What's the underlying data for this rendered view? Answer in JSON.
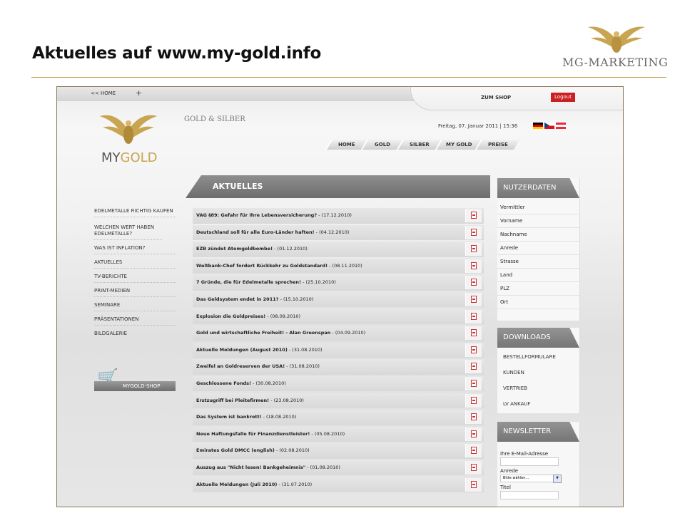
{
  "slide": {
    "title": "Aktuelles auf www.my-gold.info",
    "logo_text": "MG-MARKETING",
    "accent": "#c69a3a"
  },
  "site": {
    "top": {
      "home_link": "<< HOME",
      "plus": "+",
      "shop_link": "ZUM SHOP",
      "logout": "Logout"
    },
    "logo": {
      "my": "MY",
      "gold": "GOLD"
    },
    "tagline": "GOLD & SILBER",
    "date": "Freitag, 07. Januar 2011 | 15:36",
    "nav": [
      "HOME",
      "GOLD",
      "SILBER",
      "MY GOLD",
      "PREISE"
    ],
    "sidebar": [
      "EDELMETALLE RICHTIG KAUFEN",
      "WELCHEN WERT HABEN EDELMETALLE?",
      "WAS IST INFLATION?",
      "AKTUELLES",
      "TV-BERICHTE",
      "PRINT-MEDIEN",
      "SEMINARE",
      "PRÄSENTATIONEN",
      "BILDGALERIE"
    ],
    "shop_button": "MYGOLD-SHOP",
    "section_title": "AKTUELLES",
    "news": [
      {
        "headline": "VAG §89: Gefahr für Ihre Lebensversicherung?",
        "date": " - (17.12.2010)"
      },
      {
        "headline": "Deutschland soll für alle Euro-Länder haften!",
        "date": " - (04.12.2010)"
      },
      {
        "headline": "EZB zündet Atomgeldbombe!",
        "date": " - (01.12.2010)"
      },
      {
        "headline": "Weltbank-Chef fordert Rückkehr zu Goldstandard!",
        "date": " - (08.11.2010)"
      },
      {
        "headline": "7 Gründe, die für Edelmetalle sprechen!",
        "date": " - (25.10.2010)"
      },
      {
        "headline": "Das Geldsystem endet in 2011?",
        "date": " - (15.10.2010)"
      },
      {
        "headline": "Explosion die Goldpreises!",
        "date": " - (08.09.2010)"
      },
      {
        "headline": "Gold und wirtschaftliche Freiheit! - Alan Greenspan",
        "date": " - (04.09.2010)"
      },
      {
        "headline": "Aktuelle Meldungen (August 2010)",
        "date": " - (31.08.2010)"
      },
      {
        "headline": "Zweifel an Goldreserven der USA!",
        "date": " - (31.08.2010)"
      },
      {
        "headline": "Geschlossene Fonds!",
        "date": " - (30.08.2010)"
      },
      {
        "headline": "Erstzugriff bei Pleitefirmen!",
        "date": " - (23.08.2010)"
      },
      {
        "headline": "Das System ist bankrott!",
        "date": " - (18.08.2010)"
      },
      {
        "headline": "Neue Haftungsfalle für Finanzdienstleister!",
        "date": " - (05.08.2010)"
      },
      {
        "headline": "Emirates Gold DMCC (english)",
        "date": " - (02.08.2010)"
      },
      {
        "headline": "Auszug aus \"Nicht lesen! Bankgeheimnis\"",
        "date": " - (01.08.2010)"
      },
      {
        "headline": "Aktuelle Meldungen (Juli 2010)",
        "date": " - (31.07.2010)"
      }
    ],
    "nutzerdaten": {
      "title": "NUTZERDATEN",
      "fields": [
        "Vermittler",
        "Vorname",
        "Nachname",
        "Anrede",
        "Strasse",
        "Land",
        "PLZ",
        "Ort"
      ]
    },
    "downloads": {
      "title": "DOWNLOADS",
      "items": [
        "BESTELLFORMULARE",
        "KUNDEN",
        "VERTRIEB",
        "LV ANKAUF"
      ]
    },
    "newsletter": {
      "title": "NEWSLETTER",
      "email_label": "Ihre E-Mail-Adresse",
      "anrede_label": "Anrede",
      "anrede_value": "Bitte wählen...",
      "titel_label": "Titel"
    }
  }
}
